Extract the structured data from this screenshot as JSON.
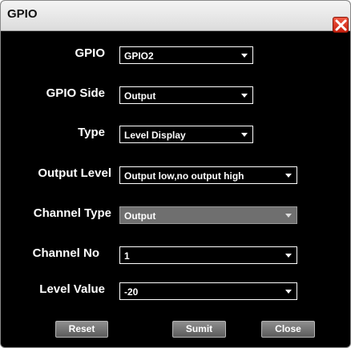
{
  "window": {
    "title": "GPIO",
    "close_icon": "close-x-icon",
    "close_color": "#d9301b"
  },
  "form": {
    "fields": [
      {
        "label": "GPIO",
        "value": "GPIO2"
      },
      {
        "label": "GPIO Side",
        "value": "Output"
      },
      {
        "label": "Type",
        "value": "Level Display"
      },
      {
        "label": "Output Level",
        "value": "Output low,no output high"
      },
      {
        "label": "Channel Type",
        "value": "Output",
        "disabled": true
      },
      {
        "label": "Channel No",
        "value": "1"
      },
      {
        "label": "Level Value",
        "value": "-20"
      }
    ]
  },
  "buttons": {
    "reset": "Reset",
    "submit": "Sumit",
    "close": "Close"
  }
}
